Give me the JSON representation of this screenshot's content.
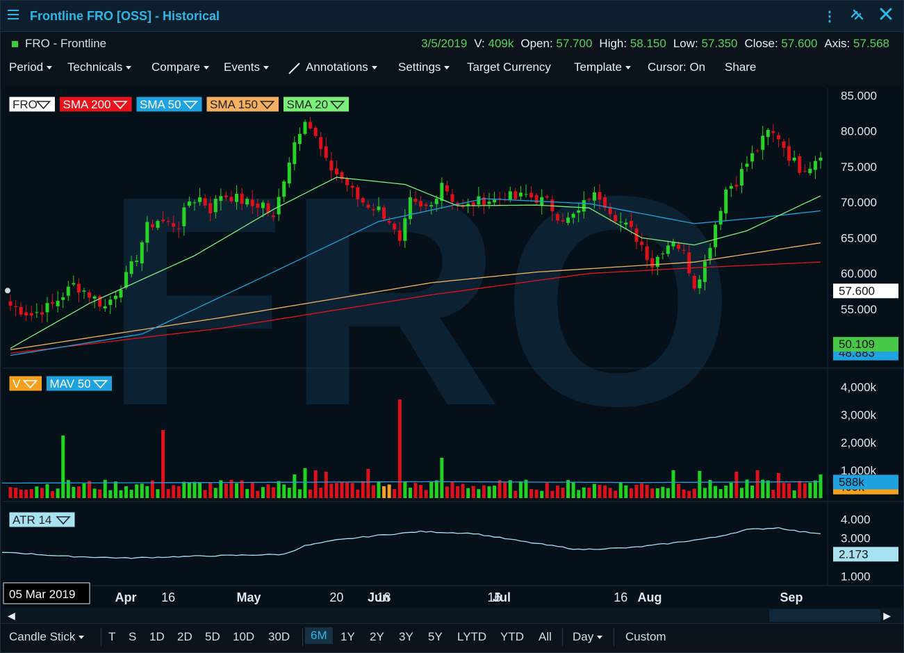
{
  "window": {
    "title": "Frontline FRO [OSS] - Historical"
  },
  "instrument": {
    "ticker_name": "FRO - Frontline"
  },
  "quote": {
    "date": "3/5/2019",
    "volume_label": "V:",
    "volume": "409k",
    "open_label": "Open:",
    "open": "57.700",
    "high_label": "High:",
    "high": "58.150",
    "low_label": "Low:",
    "low": "57.350",
    "close_label": "Close:",
    "close": "57.600",
    "axis_label": "Axis:",
    "axis": "57.568"
  },
  "toolbar": {
    "period": "Period",
    "technicals": "Technicals",
    "compare": "Compare",
    "events": "Events",
    "annotations": "Annotations",
    "settings": "Settings",
    "target_currency": "Target Currency",
    "template": "Template",
    "cursor": "Cursor: On",
    "share": "Share"
  },
  "legends": {
    "price": [
      {
        "label": "FRO",
        "color": "#ffffff",
        "text": "#222222"
      },
      {
        "label": "SMA 200",
        "color": "#e8121a",
        "text": "#ffffff"
      },
      {
        "label": "SMA 50",
        "color": "#1ea2e0",
        "text": "#ffffff"
      },
      {
        "label": "SMA 150",
        "color": "#f4b060",
        "text": "#222222"
      },
      {
        "label": "SMA 20",
        "color": "#7af07a",
        "text": "#222222"
      }
    ],
    "volume": [
      {
        "label": "V",
        "color": "#f5a020",
        "text": "#ffffff"
      },
      {
        "label": "MAV 50",
        "color": "#1ea2e0",
        "text": "#ffffff"
      }
    ],
    "atr": [
      {
        "label": "ATR 14",
        "color": "#a8e2f0",
        "text": "#222222"
      }
    ]
  },
  "watermark": "FRO",
  "axis_badges": {
    "price": [
      {
        "value": "57.600",
        "y": 57.6,
        "bg": "#ffffff",
        "fg": "#111111"
      },
      {
        "value": "50.109",
        "y": 50.109,
        "bg": "#47c847",
        "fg": "#111111"
      },
      {
        "value": "48.883",
        "y": 48.883,
        "bg": "#1ea2e0",
        "fg": "#111111"
      }
    ],
    "volume": [
      {
        "value": "588k",
        "y": 588,
        "bg": "#1ea2e0",
        "fg": "#111111"
      },
      {
        "value": "409k",
        "y": 409,
        "bg": "#f5a020",
        "fg": "#111111"
      }
    ],
    "atr": [
      {
        "value": "2.173",
        "y": 2.173,
        "bg": "#a8e2f0",
        "fg": "#111111"
      }
    ]
  },
  "x_axis": {
    "date_badge": "05 Mar 2019",
    "labels": [
      {
        "t": "Apr",
        "d": 19,
        "bold": true
      },
      {
        "t": "16",
        "d": 30,
        "bold": false
      },
      {
        "t": "May",
        "d": 40,
        "bold": true
      },
      {
        "t": "20",
        "d": 62,
        "bold": false
      },
      {
        "t": "Jun",
        "d": 61,
        "bold": true
      },
      {
        "t": "18",
        "d": 71,
        "bold": false
      },
      {
        "t": "Jul",
        "d": 80,
        "bold": true
      },
      {
        "t": "16",
        "d": 92,
        "bold": false
      },
      {
        "t": "Aug",
        "d": 105,
        "bold": true
      },
      {
        "t": "16",
        "d": 116,
        "bold": false
      },
      {
        "t": "Sep",
        "d": 128,
        "bold": true
      }
    ]
  },
  "chart_data": [
    {
      "type": "candlestick",
      "title": "",
      "ylim": [
        47,
        86
      ],
      "y_ticks": [
        55,
        60,
        65,
        70,
        75,
        80,
        85
      ],
      "y_tick_labels": [
        "55.000",
        "60.000",
        "65.000",
        "70.000",
        "75.000",
        "80.000",
        "85.000"
      ],
      "close_anchors": [
        [
          0,
          55.5
        ],
        [
          4,
          54.2
        ],
        [
          8,
          55.6
        ],
        [
          12,
          58.4
        ],
        [
          14,
          57.6
        ],
        [
          16,
          56.5
        ],
        [
          18,
          55.3
        ],
        [
          20,
          57.4
        ],
        [
          22,
          59.5
        ],
        [
          24,
          62.4
        ],
        [
          26,
          66.5
        ],
        [
          28,
          67.5
        ],
        [
          30,
          67.0
        ],
        [
          32,
          66.8
        ],
        [
          34,
          70.2
        ],
        [
          36,
          70.6
        ],
        [
          38,
          69.0
        ],
        [
          40,
          71.1
        ],
        [
          42,
          70.8
        ],
        [
          44,
          70.2
        ],
        [
          46,
          69.5
        ],
        [
          48,
          69.8
        ],
        [
          50,
          67.5
        ],
        [
          52,
          73.5
        ],
        [
          54,
          78.5
        ],
        [
          56,
          82.0
        ],
        [
          58,
          79.0
        ],
        [
          60,
          75.5
        ],
        [
          62,
          74.0
        ],
        [
          64,
          72.5
        ],
        [
          66,
          70.5
        ],
        [
          68,
          69.6
        ],
        [
          70,
          69.0
        ],
        [
          72,
          67.5
        ],
        [
          74,
          64.0
        ],
        [
          76,
          70.0
        ],
        [
          78,
          69.0
        ],
        [
          80,
          69.5
        ],
        [
          82,
          73.0
        ],
        [
          84,
          70.5
        ],
        [
          86,
          69.0
        ],
        [
          88,
          69.8
        ],
        [
          90,
          70.4
        ],
        [
          92,
          70.2
        ],
        [
          94,
          71.0
        ],
        [
          96,
          70.5
        ],
        [
          98,
          71.0
        ],
        [
          100,
          70.5
        ],
        [
          102,
          70.0
        ],
        [
          104,
          68.2
        ],
        [
          106,
          67.5
        ],
        [
          108,
          68.6
        ],
        [
          110,
          70.8
        ],
        [
          112,
          70.9
        ],
        [
          114,
          69.0
        ],
        [
          116,
          67.2
        ],
        [
          118,
          66.0
        ],
        [
          120,
          64.0
        ],
        [
          122,
          61.2
        ],
        [
          124,
          63.5
        ],
        [
          126,
          64.8
        ],
        [
          128,
          62.8
        ],
        [
          130,
          58.4
        ],
        [
          132,
          61.5
        ],
        [
          134,
          67.0
        ],
        [
          136,
          71.8
        ],
        [
          138,
          73.0
        ],
        [
          140,
          75.5
        ],
        [
          142,
          77.5
        ],
        [
          144,
          79.8
        ],
        [
          146,
          79.2
        ],
        [
          148,
          76.5
        ],
        [
          150,
          74.8
        ],
        [
          152,
          75.2
        ],
        [
          154,
          77.0
        ]
      ],
      "series": [
        {
          "name": "SMA 200",
          "color": "#e8121a",
          "anchors": [
            [
              0,
              48.8
            ],
            [
              40,
              52.3
            ],
            [
              80,
              57.0
            ],
            [
              110,
              60.0
            ],
            [
              130,
              60.8
            ],
            [
              154,
              61.6
            ]
          ]
        },
        {
          "name": "SMA 150",
          "color": "#f4b060",
          "anchors": [
            [
              0,
              49.3
            ],
            [
              40,
              53.8
            ],
            [
              80,
              58.7
            ],
            [
              100,
              60.2
            ],
            [
              130,
              61.6
            ],
            [
              154,
              64.3
            ]
          ]
        },
        {
          "name": "SMA 50",
          "color": "#1ea2e0",
          "anchors": [
            [
              0,
              48.5
            ],
            [
              25,
              51.5
            ],
            [
              50,
              60.2
            ],
            [
              70,
              67.3
            ],
            [
              90,
              70.5
            ],
            [
              110,
              69.8
            ],
            [
              130,
              67.0
            ],
            [
              142,
              67.8
            ],
            [
              154,
              68.8
            ]
          ]
        },
        {
          "name": "SMA 20",
          "color": "#7af07a",
          "anchors": [
            [
              0,
              49.5
            ],
            [
              15,
              55.8
            ],
            [
              35,
              62.5
            ],
            [
              50,
              69.0
            ],
            [
              62,
              73.5
            ],
            [
              75,
              72.5
            ],
            [
              85,
              69.5
            ],
            [
              100,
              69.6
            ],
            [
              110,
              69.2
            ],
            [
              120,
              65.0
            ],
            [
              130,
              64.0
            ],
            [
              140,
              66.0
            ],
            [
              148,
              68.8
            ],
            [
              154,
              70.9
            ]
          ]
        }
      ]
    },
    {
      "type": "bar",
      "title": "",
      "ylim": [
        0,
        4400
      ],
      "y_ticks": [
        1000,
        2000,
        3000,
        4000
      ],
      "y_tick_labels": [
        "1,000k",
        "2,000k",
        "3,000k",
        "4,000k"
      ],
      "spikes": [
        [
          10,
          2250
        ],
        [
          29,
          2450
        ],
        [
          74,
          3550
        ],
        [
          82,
          1450
        ],
        [
          68,
          1050
        ],
        [
          56,
          1080
        ],
        [
          58,
          1000
        ],
        [
          60,
          950
        ],
        [
          54,
          850
        ],
        [
          126,
          1000
        ],
        [
          131,
          980
        ],
        [
          138,
          950
        ],
        [
          142,
          1000
        ],
        [
          146,
          900
        ],
        [
          154,
          850
        ]
      ],
      "series": [
        {
          "name": "MAV 50",
          "color": "#1ea2e0",
          "anchors": [
            [
              0,
              540
            ],
            [
              40,
              560
            ],
            [
              80,
              590
            ],
            [
              120,
              560
            ],
            [
              154,
              588
            ]
          ]
        }
      ]
    },
    {
      "type": "line",
      "title": "",
      "ylim": [
        0.5,
        4.6
      ],
      "y_ticks": [
        1,
        3,
        4
      ],
      "y_tick_labels": [
        "1.000",
        "3.000",
        "4.000"
      ],
      "series": [
        {
          "name": "ATR 14",
          "color": "#a8e2f0",
          "anchors": [
            [
              0,
              2.25
            ],
            [
              10,
              2.05
            ],
            [
              22,
              1.95
            ],
            [
              35,
              2.05
            ],
            [
              52,
              2.15
            ],
            [
              56,
              2.6
            ],
            [
              62,
              2.9
            ],
            [
              70,
              3.15
            ],
            [
              78,
              3.35
            ],
            [
              88,
              3.25
            ],
            [
              98,
              2.8
            ],
            [
              108,
              2.4
            ],
            [
              118,
              2.5
            ],
            [
              126,
              2.75
            ],
            [
              134,
              3.05
            ],
            [
              140,
              3.45
            ],
            [
              146,
              3.55
            ],
            [
              150,
              3.35
            ],
            [
              154,
              3.25
            ]
          ]
        }
      ]
    }
  ],
  "bottom": {
    "chart_type": "Candle Stick",
    "buttons": [
      "T",
      "S",
      "1D",
      "2D",
      "5D",
      "10D",
      "30D"
    ],
    "ranges": [
      "6M",
      "1Y",
      "2Y",
      "3Y",
      "5Y",
      "LYTD",
      "YTD",
      "All"
    ],
    "selected": "6M",
    "interval": "Day",
    "custom": "Custom"
  }
}
